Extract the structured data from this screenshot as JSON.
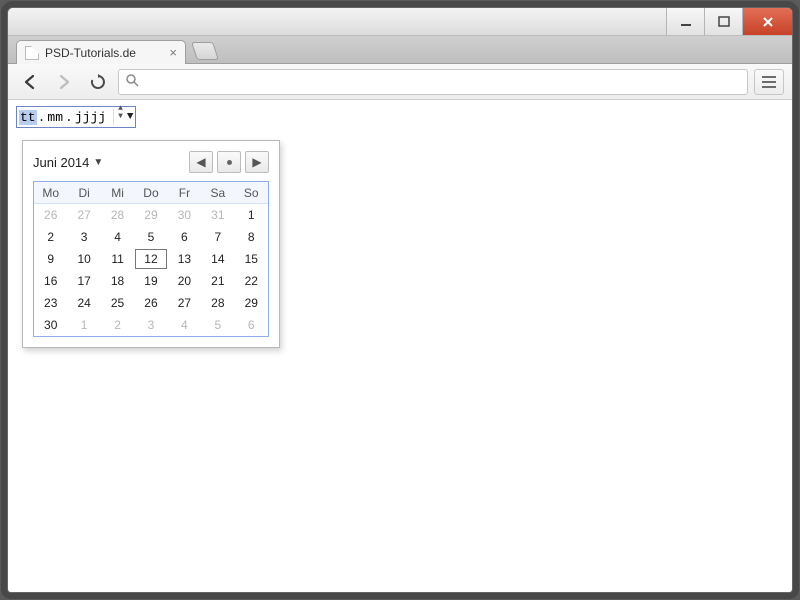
{
  "tab": {
    "title": "PSD-Tutorials.de"
  },
  "date_input": {
    "seg_day": "tt",
    "seg_month": "mm",
    "seg_year": "jjjj"
  },
  "datepicker": {
    "month_label": "Juni 2014",
    "weekdays": [
      "Mo",
      "Di",
      "Mi",
      "Do",
      "Fr",
      "Sa",
      "So"
    ],
    "today": 12,
    "weeks": [
      [
        {
          "n": 26,
          "dim": true
        },
        {
          "n": 27,
          "dim": true
        },
        {
          "n": 28,
          "dim": true
        },
        {
          "n": 29,
          "dim": true
        },
        {
          "n": 30,
          "dim": true
        },
        {
          "n": 31,
          "dim": true
        },
        {
          "n": 1
        }
      ],
      [
        {
          "n": 2
        },
        {
          "n": 3
        },
        {
          "n": 4
        },
        {
          "n": 5
        },
        {
          "n": 6
        },
        {
          "n": 7
        },
        {
          "n": 8
        }
      ],
      [
        {
          "n": 9
        },
        {
          "n": 10
        },
        {
          "n": 11
        },
        {
          "n": 12
        },
        {
          "n": 13
        },
        {
          "n": 14
        },
        {
          "n": 15
        }
      ],
      [
        {
          "n": 16
        },
        {
          "n": 17
        },
        {
          "n": 18
        },
        {
          "n": 19
        },
        {
          "n": 20
        },
        {
          "n": 21
        },
        {
          "n": 22
        }
      ],
      [
        {
          "n": 23
        },
        {
          "n": 24
        },
        {
          "n": 25
        },
        {
          "n": 26
        },
        {
          "n": 27
        },
        {
          "n": 28
        },
        {
          "n": 29
        }
      ],
      [
        {
          "n": 30
        },
        {
          "n": 1,
          "dim": true
        },
        {
          "n": 2,
          "dim": true
        },
        {
          "n": 3,
          "dim": true
        },
        {
          "n": 4,
          "dim": true
        },
        {
          "n": 5,
          "dim": true
        },
        {
          "n": 6,
          "dim": true
        }
      ]
    ]
  }
}
